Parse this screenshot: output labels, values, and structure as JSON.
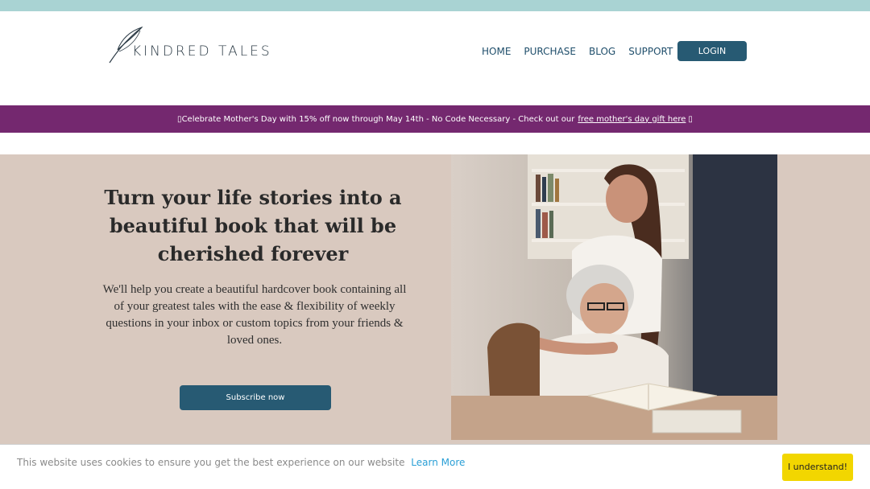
{
  "brand": {
    "name": "KINDRED TALES"
  },
  "nav": {
    "items": [
      {
        "label": "HOME"
      },
      {
        "label": "PURCHASE"
      },
      {
        "label": "BLOG"
      },
      {
        "label": "SUPPORT"
      }
    ],
    "login_label": "LOGIN"
  },
  "promo": {
    "text": "Celebrate Mother's Day with 15% off now through May 14th - No Code Necessary - Check out our",
    "link_label": "free mother's day gift here",
    "lead_icon": "party-icon",
    "trail_icon": "gift-icon"
  },
  "hero": {
    "title": "Turn your life stories into a beautiful book that will be cherished forever",
    "description": "We'll help you create a beautiful hardcover book containing all of your greatest tales with the ease & flexibility of weekly questions in your inbox or custom topics from your friends & loved ones.",
    "cta_label": "Subscribe now"
  },
  "cookie": {
    "text": "This website uses cookies to ensure you get the best experience on our website",
    "learn_more": "Learn More",
    "accept_label": "I understand!"
  },
  "colors": {
    "top_strip": "#a9d3d3",
    "promo_bg": "#74286f",
    "hero_bg": "#d9c9bf",
    "button": "#275a73",
    "cookie_button": "#f2d600",
    "link": "#2a9fd6"
  }
}
